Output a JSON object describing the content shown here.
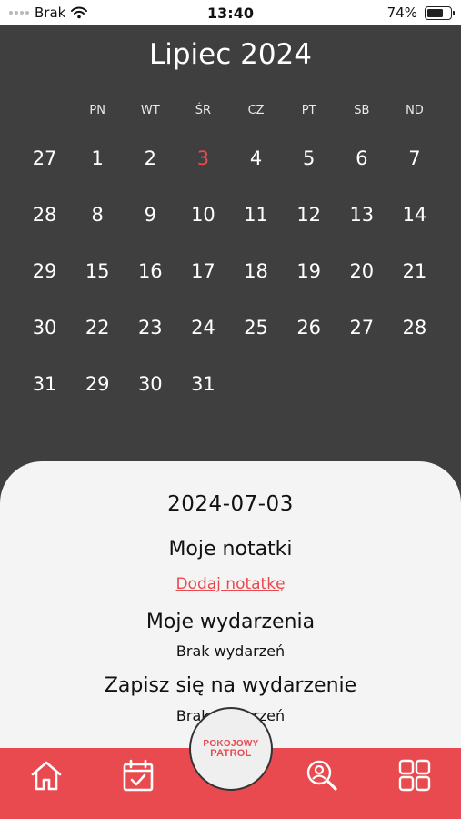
{
  "status_bar": {
    "carrier": "Brak",
    "time": "13:40",
    "battery": "74%",
    "battery_level": 0.74,
    "icons": [
      "signal-dots-icon",
      "wifi-icon",
      "battery-icon"
    ]
  },
  "calendar": {
    "month_title": "Lipiec 2024",
    "weekdays": [
      "",
      "PN",
      "WT",
      "ŚR",
      "CZ",
      "PT",
      "SB",
      "ND"
    ],
    "weeks": [
      [
        "27",
        "1",
        "2",
        "3",
        "4",
        "5",
        "6",
        "7"
      ],
      [
        "28",
        "8",
        "9",
        "10",
        "11",
        "12",
        "13",
        "14"
      ],
      [
        "29",
        "15",
        "16",
        "17",
        "18",
        "19",
        "20",
        "21"
      ],
      [
        "30",
        "22",
        "23",
        "24",
        "25",
        "26",
        "27",
        "28"
      ],
      [
        "31",
        "29",
        "30",
        "31"
      ]
    ],
    "today": "3",
    "accent_color": "#e84a4f"
  },
  "details": {
    "selected_date": "2024-07-03",
    "notes_title": "Moje notatki",
    "add_note_link": "Dodaj notatkę",
    "events_title": "Moje wydarzenia",
    "events_empty": "Brak wydarzeń",
    "signup_title": "Zapisz się na wydarzenie",
    "signup_empty": "Brak wydarzeń"
  },
  "tab_bar": {
    "color": "#e84a4f",
    "items": [
      "home-icon",
      "calendar-icon",
      "pokojowy-patrol-logo",
      "user-search-icon",
      "grid-menu-icon"
    ],
    "logo_line1": "POKOJOWY",
    "logo_line2": "PATROL"
  }
}
